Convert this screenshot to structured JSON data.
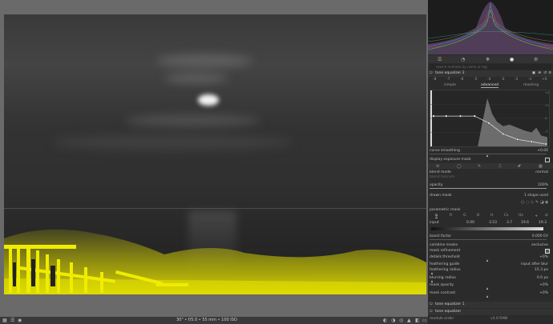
{
  "photo": {
    "mask_color": "#e8e400"
  },
  "statusbar": {
    "exif_info": "30\" • f/5.0 • 55 mm • 100 ISO"
  },
  "panel": {
    "search_placeholder": "search modules by name or tag",
    "module_title": "tone equalizer 2",
    "top_labels": [
      "-8",
      "-7",
      "-6",
      "-5",
      "-4",
      "-3",
      "-2",
      "-1",
      "+0"
    ],
    "tabs": [
      "simple",
      "advanced",
      "masking"
    ],
    "active_tab": "advanced",
    "graph_right_labels": [
      "+2",
      "+1",
      "0",
      "-1",
      "-2"
    ],
    "curve_smoothing": {
      "label": "curve smoothing",
      "value": "+0.00"
    },
    "display_exposure_mask": "display exposure mask",
    "blend_mode": {
      "label": "blend mode",
      "value": "normal"
    },
    "blend_fulcrum": "blend fulcrum",
    "opacity": {
      "label": "opacity",
      "value": "100%"
    },
    "drawn_mask": {
      "label": "drawn mask",
      "value": "1 shape used"
    },
    "parametric_mask": "parametric mask",
    "channel_tabs": [
      "g",
      "R",
      "G",
      "B",
      "H",
      "Cz",
      "Hz"
    ],
    "input": {
      "label": "input",
      "values": [
        "0.00",
        "3.53",
        "3.7",
        "19.6",
        "19.3"
      ]
    },
    "boost_factor": {
      "label": "boost factor",
      "value": "0.000 EV"
    },
    "combine_masks": {
      "label": "combine masks",
      "value": "exclusive"
    },
    "mask_refinement": "mask refinement",
    "details_threshold": {
      "label": "details threshold",
      "value": "+0%"
    },
    "feathering_guide": {
      "label": "feathering guide",
      "value": "input after blur"
    },
    "feathering_radius": {
      "label": "feathering radius",
      "value": "15.3 px"
    },
    "blurring_radius": {
      "label": "blurring radius",
      "value": "0.0 px"
    },
    "mask_opacity": {
      "label": "mask opacity",
      "value": "+0%"
    },
    "mask_contrast": {
      "label": "mask contrast",
      "value": "+0%"
    },
    "module_below_1": "tone equalizer 1",
    "module_below_2": "tone equalizer",
    "module_order": {
      "label": "module order",
      "value": "v3.0 RAW"
    }
  }
}
